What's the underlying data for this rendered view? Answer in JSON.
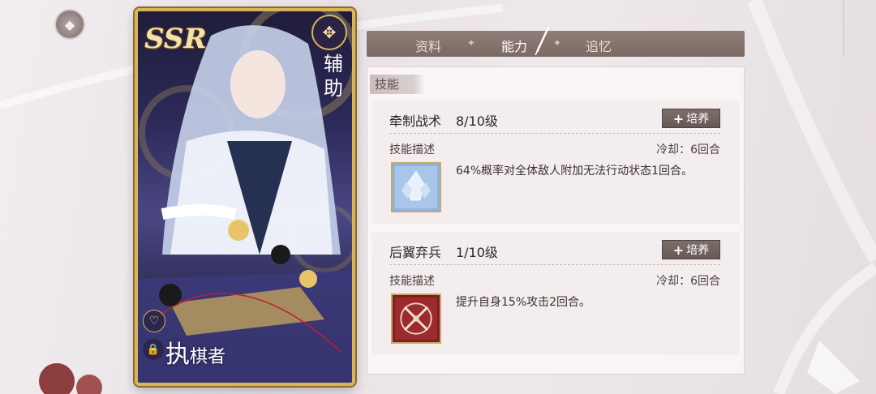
{
  "card": {
    "rarity": "SSR",
    "role": "辅助",
    "name_big": "执",
    "name_rest": "棋者"
  },
  "tabs": [
    {
      "label": "资料",
      "active": false
    },
    {
      "label": "能力",
      "active": true
    },
    {
      "label": "追忆",
      "active": false
    }
  ],
  "panel": {
    "title": "技能"
  },
  "skills": [
    {
      "name": "牵制战术",
      "level": "8/10级",
      "train_label": "培养",
      "desc_label": "技能描述",
      "cooldown": "冷却：6回合",
      "description": "64%概率对全体敌人附加无法行动状态1回合。",
      "icon": "crystal-icon"
    },
    {
      "name": "后翼弃兵",
      "level": "1/10级",
      "train_label": "培养",
      "desc_label": "技能描述",
      "cooldown": "冷却：6回合",
      "description": "提升自身15%攻击2回合。",
      "icon": "crossed-swords-icon"
    }
  ],
  "colors": {
    "card_border": "#d9b45a",
    "tab_bar": "#8f7e77",
    "button": "#6f615e"
  }
}
